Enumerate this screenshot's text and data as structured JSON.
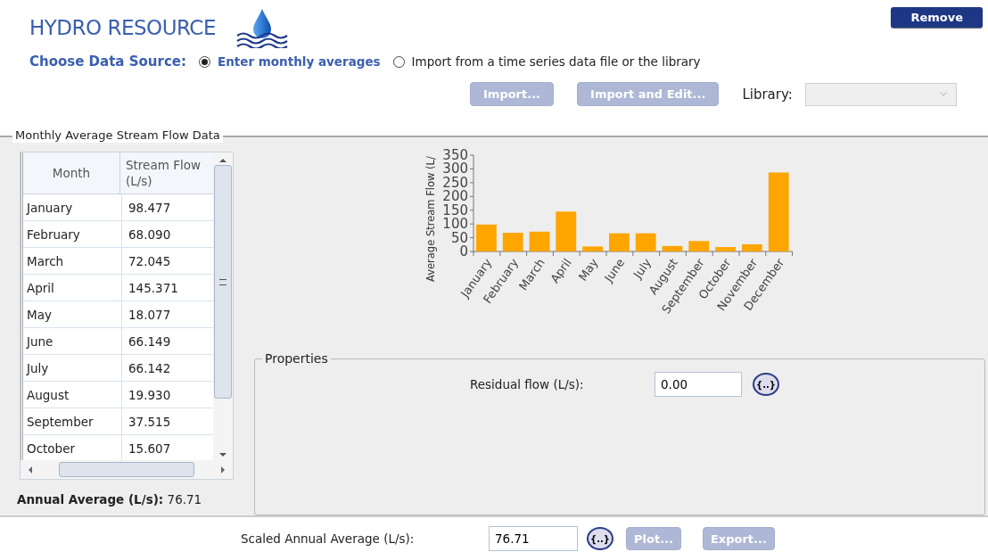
{
  "header": {
    "title": "HYDRO RESOURCE",
    "remove_button": "Remove"
  },
  "data_source": {
    "label": "Choose Data Source:",
    "options": [
      {
        "label": "Enter monthly averages",
        "selected": true
      },
      {
        "label": "Import from a time series data file or the library",
        "selected": false
      }
    ]
  },
  "import_bar": {
    "buttons": [
      {
        "label": "Import...",
        "disabled": true
      },
      {
        "label": "Import and Edit...",
        "disabled": true
      }
    ],
    "library_label": "Library:",
    "library_disabled": true
  },
  "group": {
    "title": "Monthly Average Stream Flow Data",
    "table": {
      "columns": [
        "Month",
        "Stream Flow (L/s)"
      ],
      "rows": [
        [
          "January",
          "98.477"
        ],
        [
          "February",
          "68.090"
        ],
        [
          "March",
          "72.045"
        ],
        [
          "April",
          "145.371"
        ],
        [
          "May",
          "18.077"
        ],
        [
          "June",
          "66.149"
        ],
        [
          "July",
          "66.142"
        ],
        [
          "August",
          "19.930"
        ],
        [
          "September",
          "37.515"
        ],
        [
          "October",
          "15.607"
        ]
      ]
    },
    "annual_average": {
      "label": "Annual Average (L/s):",
      "value": "76.71"
    },
    "chart_data": {
      "type": "bar",
      "ylabel": "Average Stream Flow (L/",
      "categories": [
        "January",
        "February",
        "March",
        "April",
        "May",
        "June",
        "July",
        "August",
        "September",
        "October",
        "November",
        "December"
      ],
      "series": [
        {
          "color": "#ffa500",
          "values": [
            98,
            68,
            72,
            145,
            18,
            66,
            66,
            20,
            38,
            16,
            26,
            287
          ]
        }
      ],
      "ylim": [
        0,
        350
      ],
      "yticks": [
        0,
        50,
        100,
        150,
        200,
        250,
        300,
        350
      ]
    },
    "properties": {
      "title": "Properties",
      "residual_label": "Residual flow (L/s):",
      "residual_value": "0.00",
      "var_button": "{..}"
    }
  },
  "footer": {
    "scaled_label": "Scaled Annual Average (L/s):",
    "scaled_value": "76.71",
    "var_button": "{..}",
    "buttons": [
      {
        "label": "Plot...",
        "disabled": true
      },
      {
        "label": "Export...",
        "disabled": true
      }
    ]
  }
}
